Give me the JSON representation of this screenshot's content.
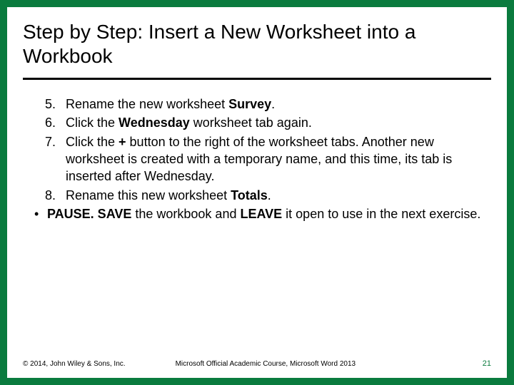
{
  "title": "Step by Step: Insert a New Worksheet into a Workbook",
  "steps": [
    {
      "num": "5.",
      "pre": "Rename the new worksheet ",
      "b1": "Survey",
      "post": "."
    },
    {
      "num": "6.",
      "pre": "Click the ",
      "b1": "Wednesday",
      "post": " worksheet tab again."
    },
    {
      "num": "7.",
      "pre": "Click the ",
      "b1": "+",
      "post": " button to the right of the worksheet tabs. Another new worksheet is created with a temporary name, and this time, its tab is inserted after Wednesday."
    },
    {
      "num": "8.",
      "pre": "Rename this new worksheet ",
      "b1": "Totals",
      "post": "."
    }
  ],
  "pause": {
    "bullet": "•",
    "b1": "PAUSE. SAVE",
    "mid1": " the workbook and ",
    "b2": "LEAVE",
    "mid2": " it open to use in the next exercise."
  },
  "footer": {
    "copyright": "© 2014, John Wiley & Sons, Inc.",
    "course": "Microsoft Official Academic Course, Microsoft Word 2013",
    "page": "21"
  }
}
